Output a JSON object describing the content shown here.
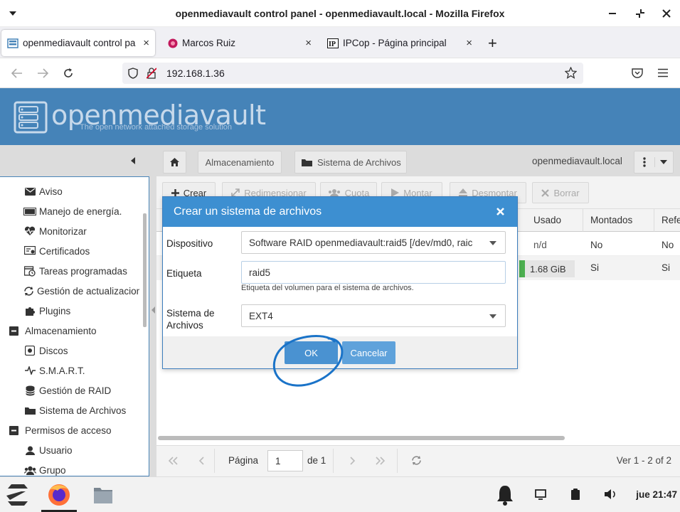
{
  "window": {
    "title": "openmediavault control panel - openmediavault.local - Mozilla Firefox"
  },
  "tabs": [
    {
      "label": "openmediavault control pa",
      "active": true
    },
    {
      "label": "Marcos Ruiz",
      "active": false
    },
    {
      "label": "IPCop - Página principal",
      "active": false
    }
  ],
  "tab_close": "×",
  "new_tab": "+",
  "address": {
    "url": "192.168.1.36"
  },
  "omv": {
    "logo_text": "openmediavault",
    "tagline": "The open network attached storage solution"
  },
  "breadcrumb": {
    "items": [
      "Almacenamiento",
      "Sistema de Archivos"
    ],
    "host": "openmediavault.local"
  },
  "sidebar": {
    "items": [
      {
        "label": "Aviso",
        "icon": "mail-icon"
      },
      {
        "label": "Manejo de energía.",
        "icon": "battery-icon"
      },
      {
        "label": "Monitorizar",
        "icon": "heartbeat-icon"
      },
      {
        "label": "Certificados",
        "icon": "certificate-icon"
      },
      {
        "label": "Tareas programadas",
        "icon": "calendar-clock-icon"
      },
      {
        "label": "Gestión de actualizacion",
        "icon": "refresh-icon"
      },
      {
        "label": "Plugins",
        "icon": "puzzle-icon"
      },
      {
        "label": "Almacenamiento",
        "icon": "collapse-icon"
      },
      {
        "label": "Discos",
        "icon": "disk-icon"
      },
      {
        "label": "S.M.A.R.T.",
        "icon": "pulse-icon"
      },
      {
        "label": "Gestión de RAID",
        "icon": "database-icon"
      },
      {
        "label": "Sistema de Archivos",
        "icon": "folder-icon"
      },
      {
        "label": "Permisos de acceso",
        "icon": "collapse-icon"
      },
      {
        "label": "Usuario",
        "icon": "user-icon"
      },
      {
        "label": "Grupo",
        "icon": "group-icon"
      }
    ]
  },
  "toolbar": {
    "create": "Crear",
    "resize": "Redimensionar",
    "quota": "Cuota",
    "mount": "Montar",
    "unmount": "Desmontar",
    "delete": "Borrar"
  },
  "table": {
    "columns": [
      "Usado",
      "Montados",
      "Refe"
    ],
    "rows": [
      {
        "used": "n/d",
        "mounted": "No",
        "ref": "No"
      },
      {
        "used": "1.68 GiB",
        "mounted": "Si",
        "ref": "Si"
      }
    ]
  },
  "pager": {
    "page_label": "Página",
    "page_value": "1",
    "of_label": "de 1",
    "summary": "Ver 1 - 2 of 2"
  },
  "dialog": {
    "title": "Crear un sistema de archivos",
    "device_label": "Dispositivo",
    "device_value": "Software RAID openmediavault:raid5 [/dev/md0, raic",
    "tag_label": "Etiqueta",
    "tag_value": "raid5",
    "tag_hint": "Etiqueta del volumen para el sistema de archivos.",
    "fs_label_1": "Sistema de",
    "fs_label_2": "Archivos",
    "fs_value": "EXT4",
    "ok": "OK",
    "cancel": "Cancelar"
  },
  "taskbar": {
    "clock": "jue 21:47"
  },
  "colors": {
    "omv_header": "#4583b8",
    "dialog_header": "#3d8fd1",
    "button": "#4a92d1",
    "used_bar": "#4caf50",
    "annotation": "#1a73c8"
  }
}
